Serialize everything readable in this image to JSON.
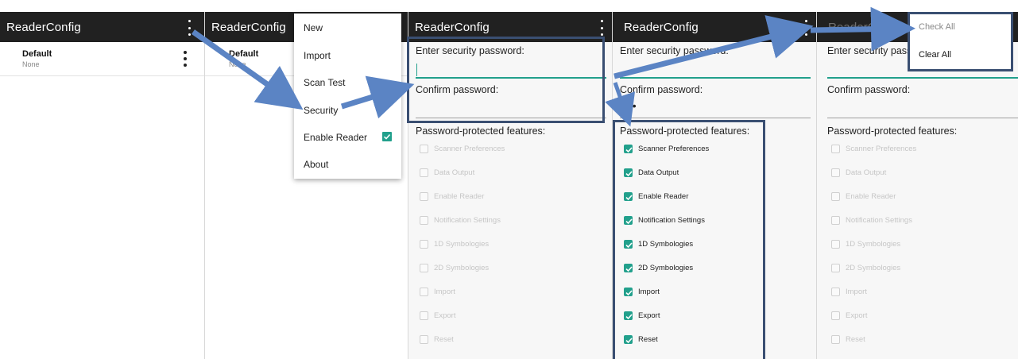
{
  "app_title": "ReaderConfig",
  "profile": {
    "name": "Default",
    "sub": "None"
  },
  "menu": {
    "items": [
      "New",
      "Import",
      "Scan Test",
      "Security",
      "Enable Reader",
      "About"
    ],
    "enable_reader_checked": true
  },
  "security": {
    "password_label": "Enter security password:",
    "confirm_label": "Confirm password:",
    "confirm_dots": "• •",
    "features_label": "Password-protected features:"
  },
  "features": [
    "Scanner Preferences",
    "Data Output",
    "Enable Reader",
    "Notification Settings",
    "1D Symbologies",
    "2D Symbologies",
    "Import",
    "Export",
    "Reset"
  ],
  "features_checked_panel4": [
    true,
    true,
    true,
    true,
    true,
    true,
    true,
    true,
    true
  ],
  "popup": {
    "check_all": "Check All",
    "clear_all": "Clear All"
  },
  "colors": {
    "appbar": "#212121",
    "accent": "#22a08c",
    "callout_arrow": "#5b84c4",
    "highlight_box": "#3a4f72"
  }
}
